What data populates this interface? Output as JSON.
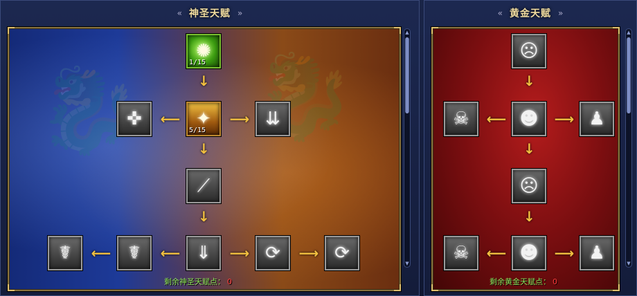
{
  "holy_panel": {
    "title": "神圣天赋",
    "remaining_label": "剩余神圣天赋点：",
    "remaining_points": "0",
    "ornament_left": "«",
    "ornament_right": "»",
    "nodes": [
      {
        "icon": "green-swirl-icon",
        "glyph": "✺",
        "level": "1/15"
      },
      {
        "icon": "golden-rays-icon",
        "glyph": "✦",
        "level": "5/15"
      },
      {
        "icon": "shadow-beast-icon",
        "glyph": "✜",
        "level": ""
      },
      {
        "icon": "light-pillar-icon",
        "glyph": "⇊",
        "level": ""
      },
      {
        "icon": "blade-shard-icon",
        "glyph": "⟋",
        "level": ""
      },
      {
        "icon": "falling-light-icon",
        "glyph": "⇓",
        "level": ""
      },
      {
        "icon": "angel-wings-icon",
        "glyph": "☤",
        "level": ""
      },
      {
        "icon": "angel-wings-icon",
        "glyph": "☤",
        "level": ""
      },
      {
        "icon": "spinning-blade-icon",
        "glyph": "⟳",
        "level": ""
      },
      {
        "icon": "spinning-blade-icon",
        "glyph": "⟳",
        "level": ""
      }
    ]
  },
  "gold_panel": {
    "title": "黄金天赋",
    "remaining_label": "剩余黄金天赋点：",
    "remaining_points": "0",
    "ornament_left": "«",
    "ornament_right": "»",
    "nodes": [
      {
        "icon": "screaming-ghost-icon",
        "glyph": "☹",
        "level": ""
      },
      {
        "icon": "skull-icon",
        "glyph": "☠",
        "level": ""
      },
      {
        "icon": "hooded-ghost-icon",
        "glyph": "☻",
        "level": ""
      },
      {
        "icon": "shadow-figure-icon",
        "glyph": "♟",
        "level": ""
      },
      {
        "icon": "screaming-ghost-icon",
        "glyph": "☹",
        "level": ""
      },
      {
        "icon": "skull-icon",
        "glyph": "☠",
        "level": ""
      },
      {
        "icon": "hooded-ghost-icon",
        "glyph": "☻",
        "level": ""
      },
      {
        "icon": "shadow-figure-icon",
        "glyph": "♟",
        "level": ""
      }
    ]
  },
  "arrows": {
    "down": "↓",
    "left": "⟵",
    "right": "⟶"
  },
  "scrollbar": {
    "up": "▲",
    "down": "▼"
  },
  "colors": {
    "accent_gold": "#f2c040",
    "points_label": "#8ee05a",
    "points_value": "#ff3a3a"
  }
}
